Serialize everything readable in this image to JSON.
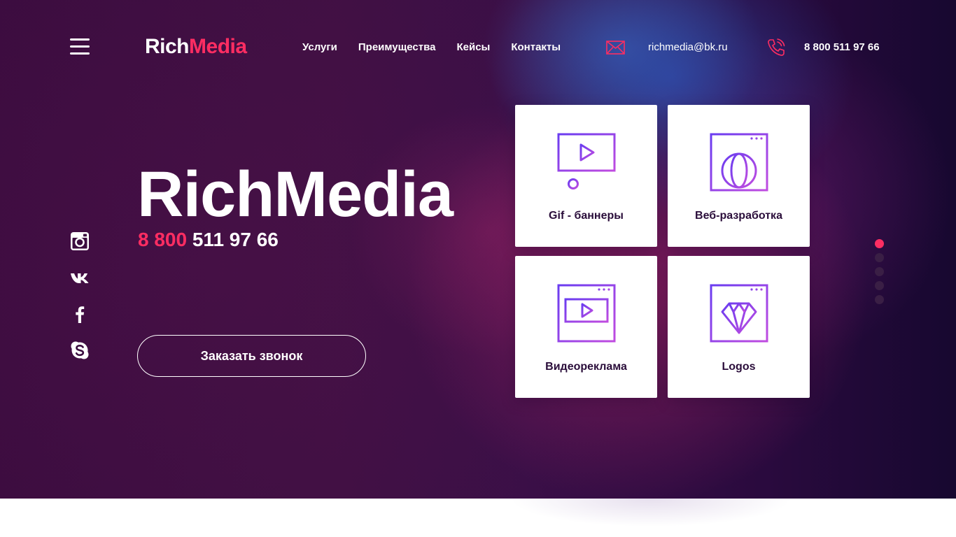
{
  "header": {
    "logo": {
      "part1": "Rich",
      "part2": "Media"
    },
    "nav": [
      "Услуги",
      "Преимущества",
      "Кейсы",
      "Контакты"
    ],
    "email": "richmedia@bk.ru",
    "phone": "8 800 511 97 66"
  },
  "hero": {
    "title": "RichMedia",
    "phone_prefix": "8 800",
    "phone_rest": "511 97 66",
    "cta_label": "Заказать звонок"
  },
  "socials": [
    "instagram-icon",
    "vk-icon",
    "facebook-icon",
    "skype-icon"
  ],
  "services": [
    {
      "label": "Gif - баннеры",
      "icon": "video-player-icon"
    },
    {
      "label": "Веб-разработка",
      "icon": "globe-browser-icon"
    },
    {
      "label": "Видеореклама",
      "icon": "video-article-icon"
    },
    {
      "label": "Logos",
      "icon": "diamond-browser-icon"
    }
  ],
  "slider": {
    "total": 5,
    "active": 1
  },
  "colors": {
    "accent": "#ff2d62",
    "background": "#3b0c3f",
    "card": "#ffffff",
    "card_text": "#2a0d3a",
    "icon_gradient_start": "#6a3cf0",
    "icon_gradient_end": "#c04ce0"
  }
}
